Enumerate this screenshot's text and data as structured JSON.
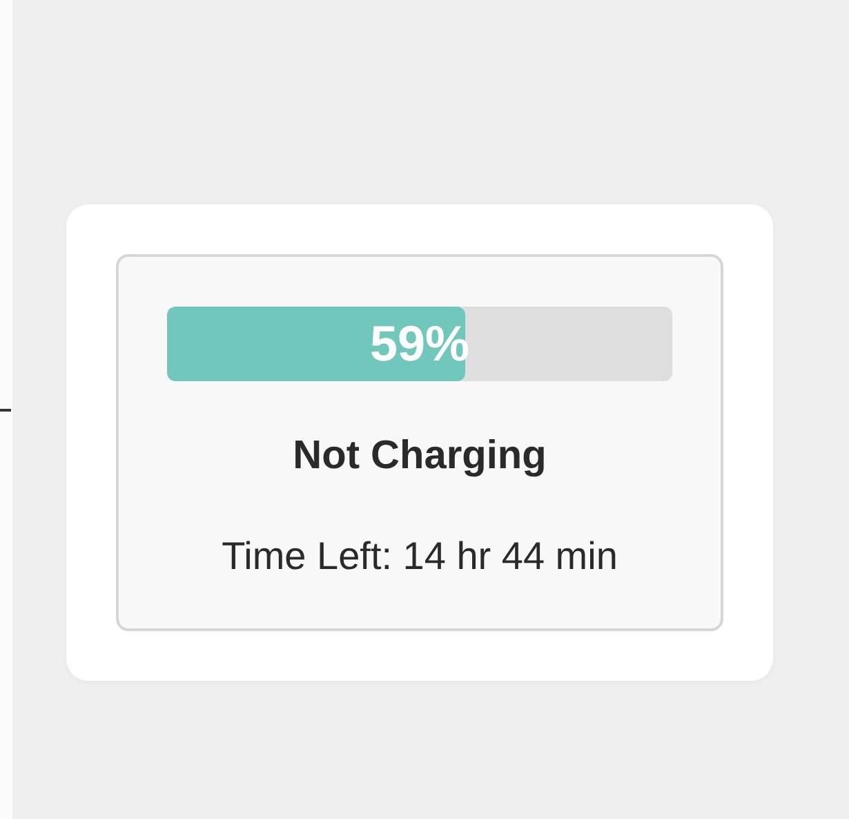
{
  "battery": {
    "level": 0.59,
    "percent": "59%",
    "status": "Not Charging",
    "time_left": "Time Left: 14 hr 44 min"
  }
}
